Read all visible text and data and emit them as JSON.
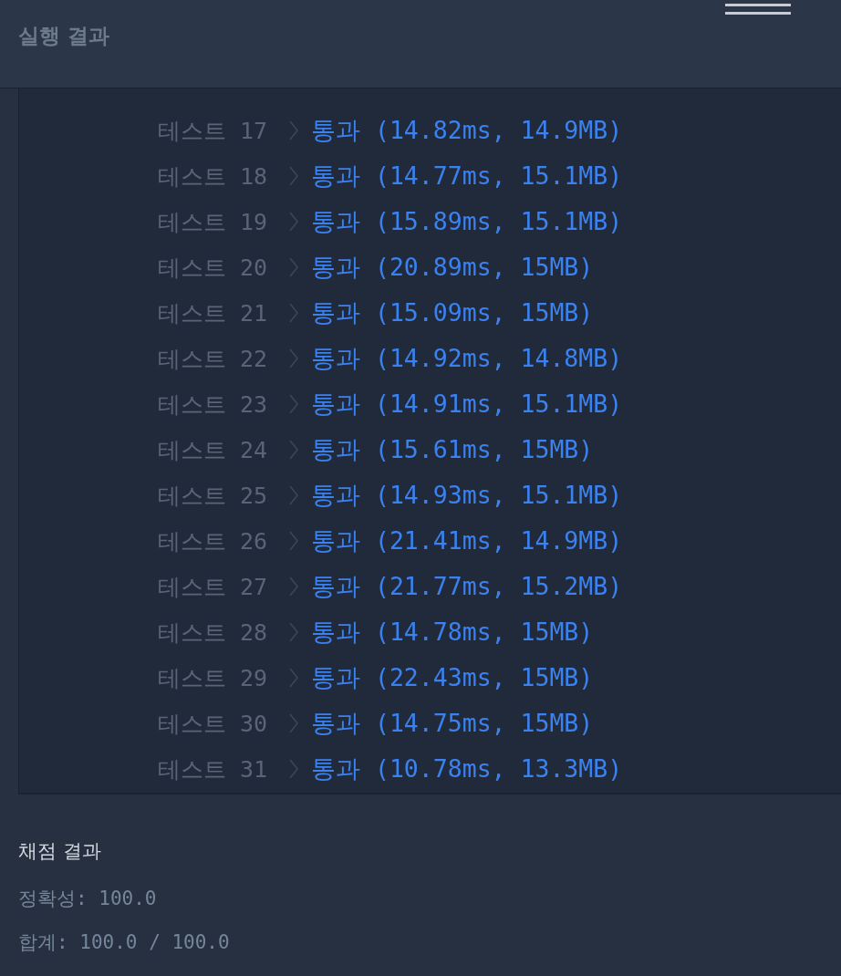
{
  "header": {
    "title": "실행 결과"
  },
  "results": [
    {
      "label": "테스트 17",
      "kind": "pass",
      "result": "통과 (14.82ms, 14.9MB)"
    },
    {
      "label": "테스트 18",
      "kind": "pass",
      "result": "통과 (14.77ms, 15.1MB)"
    },
    {
      "label": "테스트 19",
      "kind": "pass",
      "result": "통과 (15.89ms, 15.1MB)"
    },
    {
      "label": "테스트 20",
      "kind": "pass",
      "result": "통과 (20.89ms, 15MB)"
    },
    {
      "label": "테스트 21",
      "kind": "pass",
      "result": "통과 (15.09ms, 15MB)"
    },
    {
      "label": "테스트 22",
      "kind": "pass",
      "result": "통과 (14.92ms, 14.8MB)"
    },
    {
      "label": "테스트 23",
      "kind": "pass",
      "result": "통과 (14.91ms, 15.1MB)"
    },
    {
      "label": "테스트 24",
      "kind": "pass",
      "result": "통과 (15.61ms, 15MB)"
    },
    {
      "label": "테스트 25",
      "kind": "pass",
      "result": "통과 (14.93ms, 15.1MB)"
    },
    {
      "label": "테스트 26",
      "kind": "pass",
      "result": "통과 (21.41ms, 14.9MB)"
    },
    {
      "label": "테스트 27",
      "kind": "pass",
      "result": "통과 (21.77ms, 15.2MB)"
    },
    {
      "label": "테스트 28",
      "kind": "pass",
      "result": "통과 (14.78ms, 15MB)"
    },
    {
      "label": "테스트 29",
      "kind": "pass",
      "result": "통과 (22.43ms, 15MB)"
    },
    {
      "label": "테스트 30",
      "kind": "pass",
      "result": "통과 (14.75ms, 15MB)"
    },
    {
      "label": "테스트 31",
      "kind": "pass",
      "result": "통과 (10.78ms, 13.3MB)"
    }
  ],
  "grading": {
    "title": "채점 결과",
    "lines": [
      "정확성: 100.0",
      "합계: 100.0 / 100.0"
    ]
  }
}
